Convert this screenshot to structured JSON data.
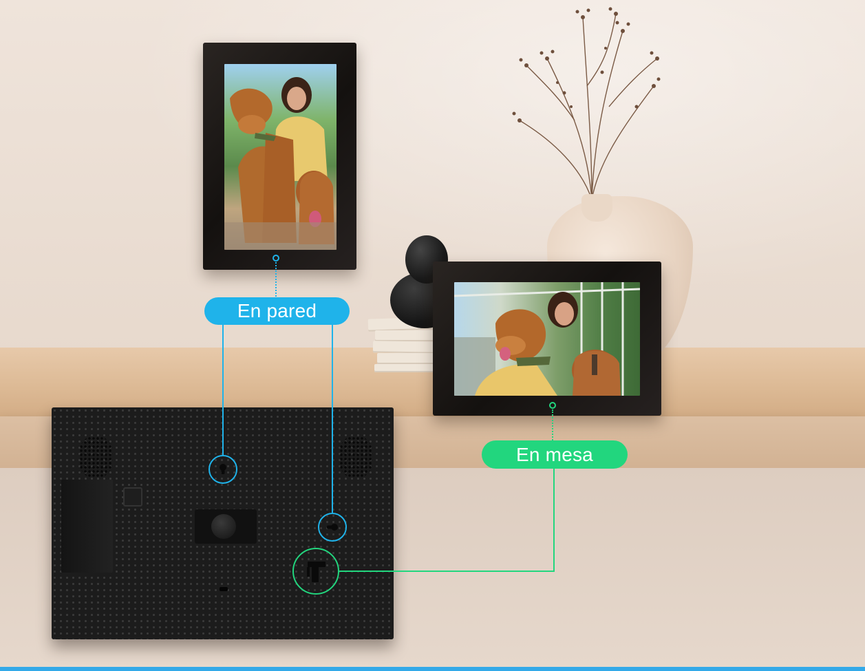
{
  "callouts": {
    "wall_label": "En pared",
    "table_label": "En mesa"
  },
  "colors": {
    "wall_accent": "#1fb3ea",
    "table_accent": "#22d67e",
    "bottom_line": "#33a9e8"
  },
  "icons": {
    "wall_mount_hole_1": "keyhole-icon",
    "wall_mount_hole_2": "keyhole-icon",
    "stand_slot": "stand-slot-icon"
  }
}
